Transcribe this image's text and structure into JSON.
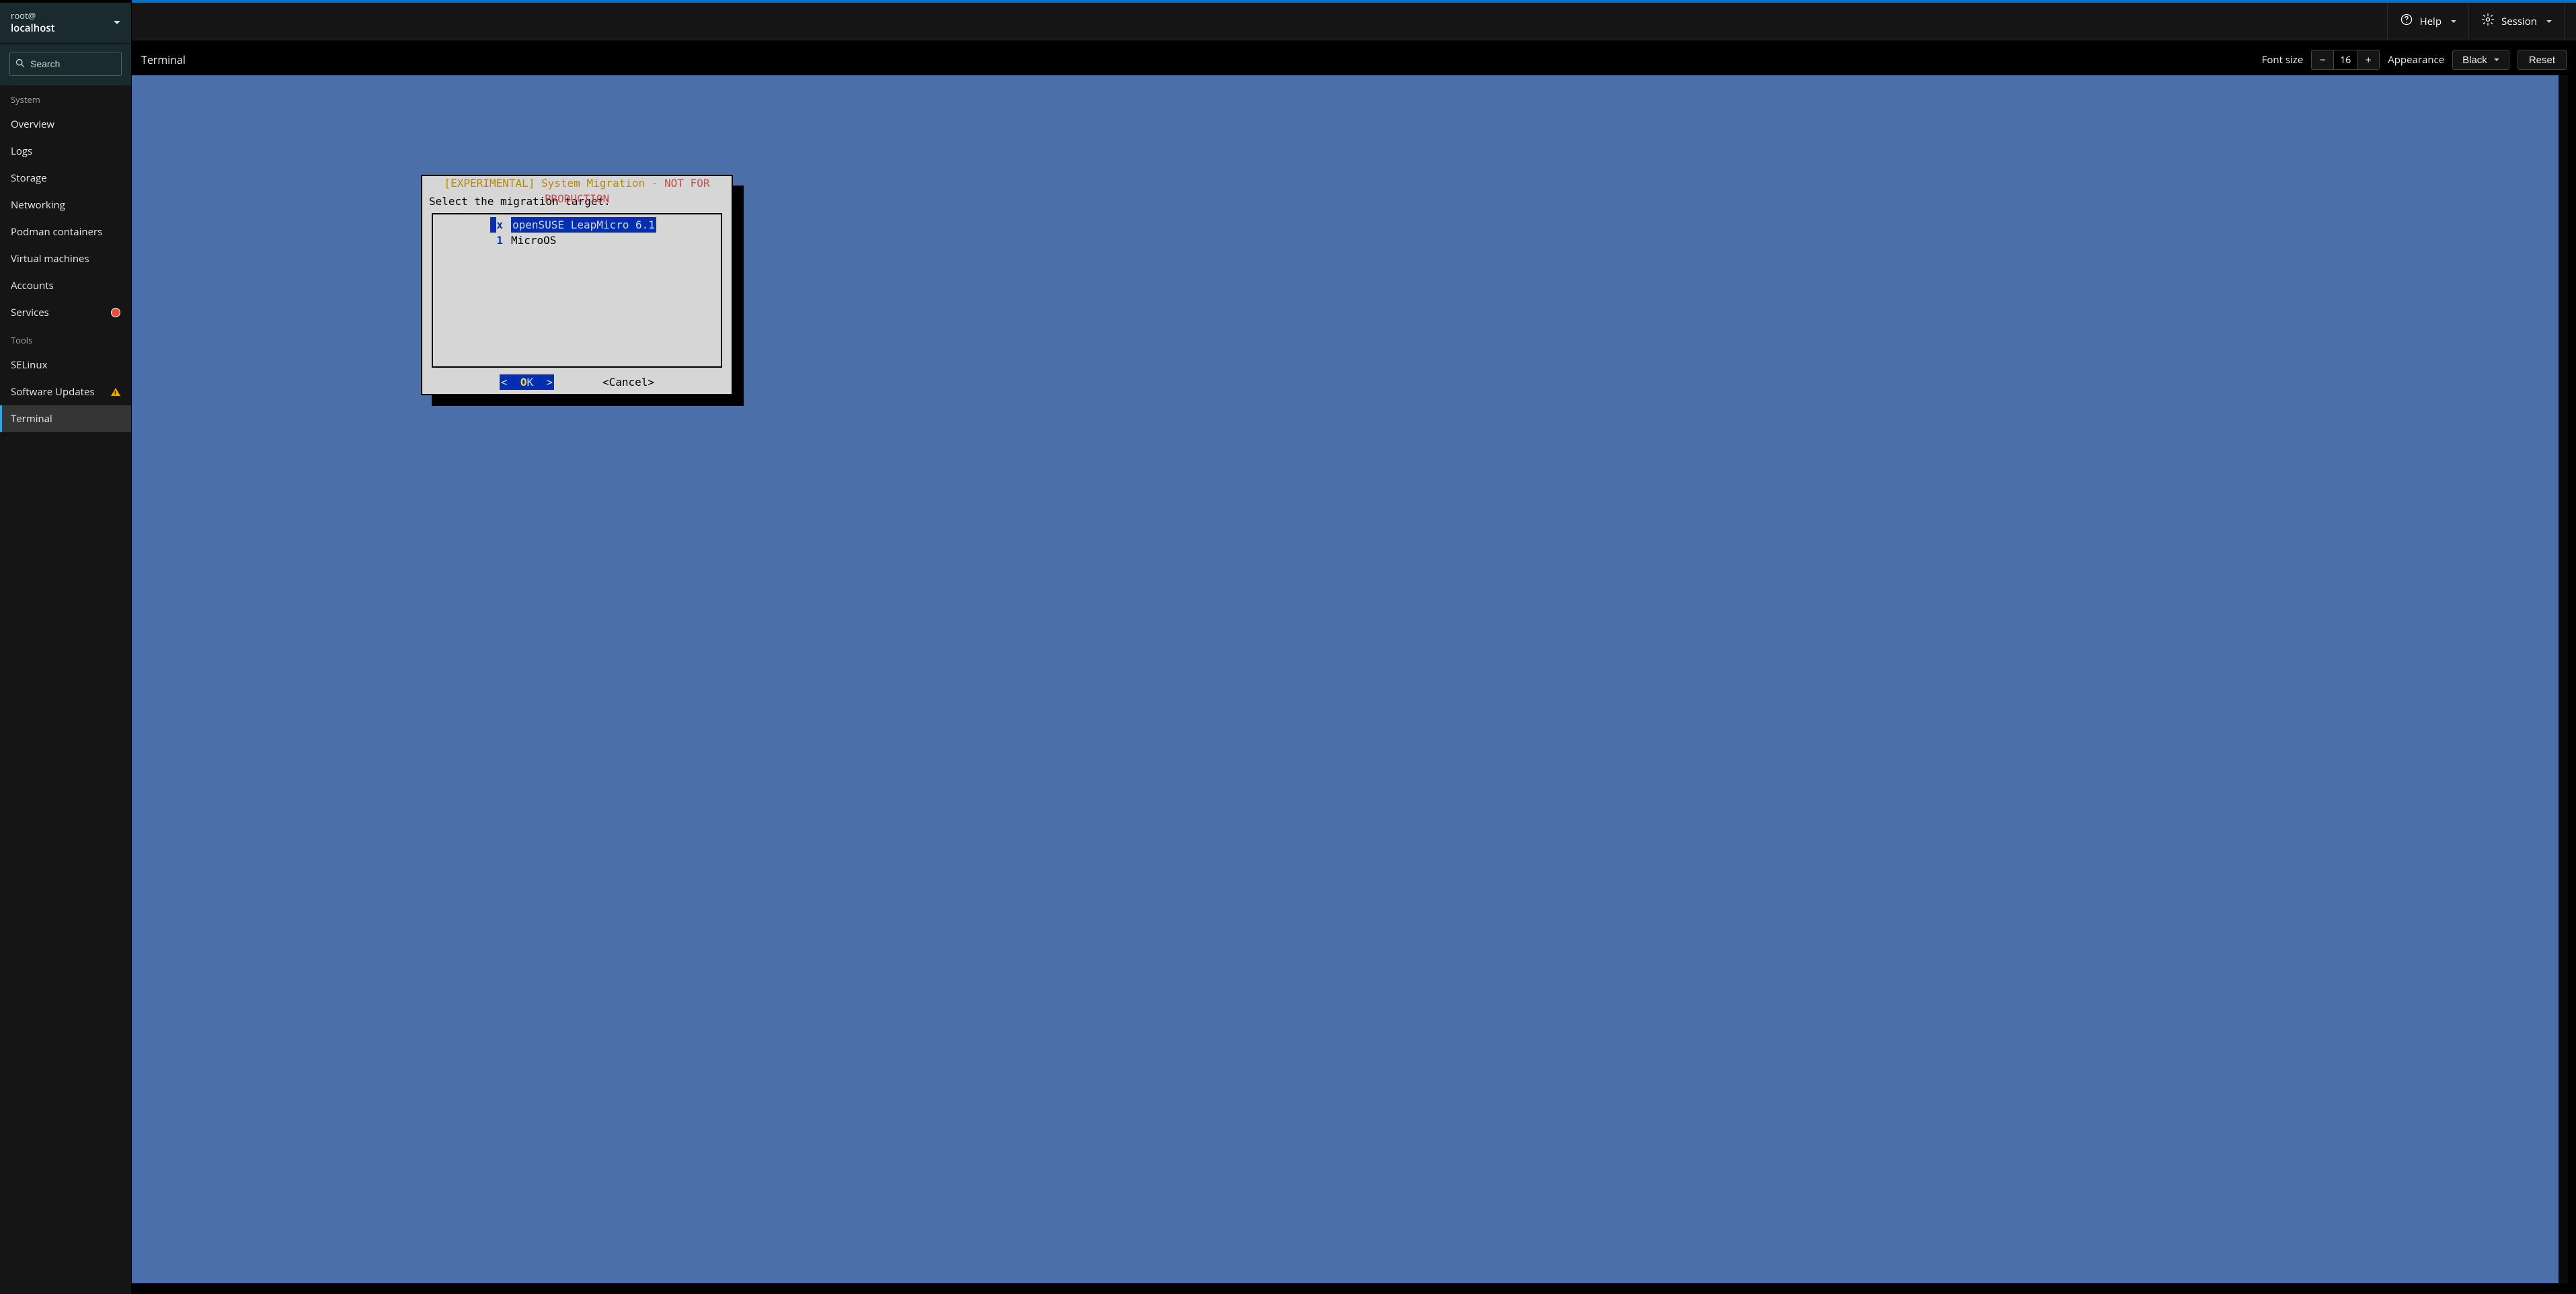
{
  "header": {
    "help_label": "Help",
    "session_label": "Session"
  },
  "host": {
    "user_at": "root@",
    "hostname": "localhost"
  },
  "search": {
    "placeholder": "Search"
  },
  "nav": {
    "system_section": "System",
    "tools_section": "Tools",
    "items_system": [
      "Overview",
      "Logs",
      "Storage",
      "Networking",
      "Podman containers",
      "Virtual machines",
      "Accounts",
      "Services"
    ],
    "items_tools": [
      "SELinux",
      "Software Updates",
      "Terminal"
    ]
  },
  "page": {
    "title": "Terminal",
    "font_size_label": "Font size",
    "font_size_value": "16",
    "appearance_label": "Appearance",
    "appearance_value": "Black",
    "reset_label": "Reset"
  },
  "tui": {
    "title_exp": "[EXPERIMENTAL] System Migration",
    "title_dash": " - ",
    "title_warn": "NOT FOR PRODUCTION",
    "prompt": "Select the migration target:",
    "rows": [
      {
        "num_cursor": " ",
        "num": "x",
        "label": "openSUSE LeapMicro 6.1",
        "selected": true
      },
      {
        "num_cursor": "",
        "num": "1",
        "label": "MicroOS",
        "selected": false
      }
    ],
    "ok_pre": "<  ",
    "ok_hot": "O",
    "ok_rest": "K  >",
    "cancel": "<Cancel>"
  }
}
